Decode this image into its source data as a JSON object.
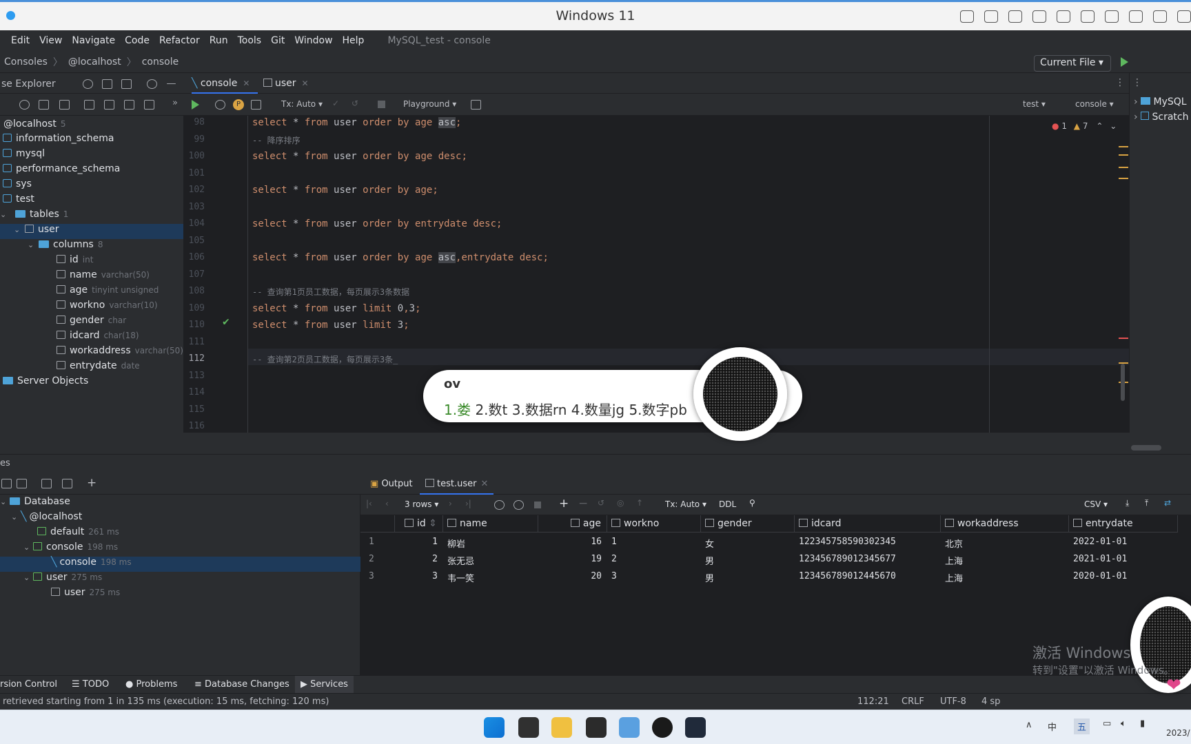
{
  "vm": {
    "title": "Windows 11"
  },
  "menu": {
    "items": [
      "Edit",
      "View",
      "Navigate",
      "Code",
      "Refactor",
      "Run",
      "Tools",
      "Git",
      "Window",
      "Help"
    ],
    "project": "MySQL_test - console"
  },
  "nav": {
    "crumbs": [
      "Consoles",
      "@localhost",
      "console"
    ],
    "run_config": "Current File"
  },
  "db_explorer": {
    "title": "se Explorer"
  },
  "tree": {
    "host": "@localhost",
    "host_count": "5",
    "schemas": [
      "information_schema",
      "mysql",
      "performance_schema",
      "sys",
      "test"
    ],
    "tables_label": "tables",
    "tables_count": "1",
    "table": "user",
    "columns_label": "columns",
    "columns_count": "8",
    "columns": [
      {
        "name": "id",
        "type": "int"
      },
      {
        "name": "name",
        "type": "varchar(50)"
      },
      {
        "name": "age",
        "type": "tinyint unsigned"
      },
      {
        "name": "workno",
        "type": "varchar(10)"
      },
      {
        "name": "gender",
        "type": "char"
      },
      {
        "name": "idcard",
        "type": "char(18)"
      },
      {
        "name": "workaddress",
        "type": "varchar(50)"
      },
      {
        "name": "entrydate",
        "type": "date"
      }
    ],
    "server_objects": "Server Objects"
  },
  "editor_tabs": [
    {
      "label": "console",
      "active": true
    },
    {
      "label": "user",
      "active": false
    }
  ],
  "editor_toolbar": {
    "tx": "Tx: Auto",
    "playground": "Playground",
    "schema": "test",
    "session": "console",
    "errors": "1",
    "warnings": "7"
  },
  "code": {
    "current_line": "112",
    "lines": [
      {
        "n": "98",
        "segs": [
          [
            "kw",
            "select"
          ],
          [
            "t",
            " * "
          ],
          [
            "kw",
            "from"
          ],
          [
            "t",
            " user "
          ],
          [
            "kw",
            "order by age "
          ],
          [
            "hl",
            "asc"
          ],
          [
            "kw",
            ";"
          ]
        ]
      },
      {
        "n": "99",
        "segs": [
          [
            "cm",
            "-- 降序排序"
          ]
        ]
      },
      {
        "n": "100",
        "segs": [
          [
            "kw",
            "select"
          ],
          [
            "t",
            " * "
          ],
          [
            "kw",
            "from"
          ],
          [
            "t",
            " user "
          ],
          [
            "kw",
            "order by age desc;"
          ]
        ]
      },
      {
        "n": "101",
        "segs": []
      },
      {
        "n": "102",
        "segs": [
          [
            "kw",
            "select"
          ],
          [
            "t",
            " * "
          ],
          [
            "kw",
            "from"
          ],
          [
            "t",
            " user "
          ],
          [
            "kw",
            "order by age;"
          ]
        ]
      },
      {
        "n": "103",
        "segs": []
      },
      {
        "n": "104",
        "segs": [
          [
            "kw",
            "select"
          ],
          [
            "t",
            " * "
          ],
          [
            "kw",
            "from"
          ],
          [
            "t",
            " user "
          ],
          [
            "kw",
            "order by entrydate desc;"
          ]
        ]
      },
      {
        "n": "105",
        "segs": []
      },
      {
        "n": "106",
        "segs": [
          [
            "kw",
            "select"
          ],
          [
            "t",
            " * "
          ],
          [
            "kw",
            "from"
          ],
          [
            "t",
            " user "
          ],
          [
            "kw",
            "order by age "
          ],
          [
            "hl",
            "asc"
          ],
          [
            "kw",
            ",entrydate desc;"
          ]
        ]
      },
      {
        "n": "107",
        "segs": []
      },
      {
        "n": "108",
        "segs": [
          [
            "cm",
            "-- 查询第1页员工数据，每页展示3条数据"
          ]
        ]
      },
      {
        "n": "109",
        "segs": [
          [
            "kw",
            "select"
          ],
          [
            "t",
            " * "
          ],
          [
            "kw",
            "from"
          ],
          [
            "t",
            " user "
          ],
          [
            "kw",
            "limit "
          ],
          [
            "t",
            "0"
          ],
          [
            "kw",
            ","
          ],
          [
            "t",
            "3"
          ],
          [
            "kw",
            ";"
          ]
        ]
      },
      {
        "n": "110",
        "segs": [
          [
            "kw",
            "select"
          ],
          [
            "t",
            " * "
          ],
          [
            "kw",
            "from"
          ],
          [
            "t",
            " user "
          ],
          [
            "kw",
            "limit "
          ],
          [
            "t",
            "3"
          ],
          [
            "kw",
            ";"
          ]
        ]
      },
      {
        "n": "111",
        "segs": []
      },
      {
        "n": "112",
        "segs": [
          [
            "cm",
            "-- 查询第2页员工数据，每页展示3条_"
          ]
        ]
      },
      {
        "n": "113",
        "segs": []
      },
      {
        "n": "114",
        "segs": []
      },
      {
        "n": "115",
        "segs": []
      },
      {
        "n": "116",
        "segs": []
      }
    ]
  },
  "ime": {
    "pinyin": "ov",
    "candidates": [
      "1.娄",
      "2.数t",
      "3.数据rn",
      "4.数量jg",
      "5.数字pb"
    ]
  },
  "right_panel": {
    "items": [
      "MySQL",
      "Scratch"
    ]
  },
  "services": {
    "header": "es",
    "root": "Database",
    "nodes": [
      {
        "label": "@localhost",
        "time": "",
        "level": 1
      },
      {
        "label": "default",
        "time": "261 ms",
        "level": 2
      },
      {
        "label": "console",
        "time": "198 ms",
        "level": 2
      },
      {
        "label": "console",
        "time": "198 ms",
        "level": 3,
        "selected": true
      },
      {
        "label": "user",
        "time": "275 ms",
        "level": 2
      },
      {
        "label": "user",
        "time": "275 ms",
        "level": 3
      }
    ]
  },
  "results": {
    "tabs": [
      "Output",
      "test.user"
    ],
    "rows_label": "3 rows",
    "tx": "Tx: Auto",
    "ddl": "DDL",
    "format": "CSV",
    "columns": [
      "id",
      "name",
      "age",
      "workno",
      "gender",
      "idcard",
      "workaddress",
      "entrydate"
    ],
    "rows": [
      [
        "1",
        "1",
        "柳岩",
        "16",
        "1",
        "女",
        "122345758590302345",
        "北京",
        "2022-01-01"
      ],
      [
        "2",
        "2",
        "张无忌",
        "19",
        "2",
        "男",
        "123456789012345677",
        "上海",
        "2021-01-01"
      ],
      [
        "3",
        "3",
        "韦一笑",
        "20",
        "3",
        "男",
        "123456789012445670",
        "上海",
        "2020-01-01"
      ]
    ]
  },
  "bottom_tabs": [
    "rsion Control",
    "TODO",
    "Problems",
    "Database Changes",
    "Services"
  ],
  "status": {
    "message": "retrieved starting from 1 in 135 ms (execution: 15 ms, fetching: 120 ms)",
    "position": "112:21",
    "line_sep": "CRLF",
    "encoding": "UTF-8",
    "indent": "4 sp"
  },
  "watermark": {
    "line1": "激活 Windows",
    "line2": "转到\"设置\"以激活 Windows。"
  },
  "taskbar": {
    "ime_indicator": "中",
    "ime_mode": "五",
    "date": "2023/"
  }
}
